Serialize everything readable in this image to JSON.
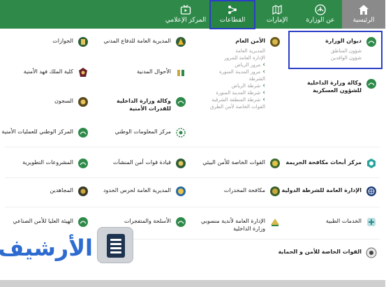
{
  "nav": {
    "home": "الرئيسية",
    "ministry": "عن الوزارة",
    "emirates": "الإمارات",
    "sectors": "القطاعات",
    "media": "المركز الإعلامي"
  },
  "col1": [
    {
      "title": "ديوان الوزارة",
      "subs": [
        "شؤون المناطق",
        "شؤون الوافدين"
      ]
    },
    {
      "title": "وكالة وزارة الداخلية للشؤون العسكرية"
    },
    {
      "title": "مركز أبحاث مكافحة الجريمة"
    },
    {
      "title": "الإدارة العامة للشرطة الدولية"
    },
    {
      "title": "الخدمات الطبية"
    },
    {
      "title": "القوات الخاصة للأمن و الحماية"
    }
  ],
  "col2": [
    {
      "title": "الأمن العام",
      "subs": [
        "المديرية العامة",
        "الإدارة العامة للمرور",
        "مرور الرياض",
        "مرور المدينة المنورة",
        "الشرطة",
        "شرطة الرياض",
        "شرطة المدينة المنورة",
        "شرطة المنطقة الشرقية",
        "القوات الخاصة لأمن الطرق"
      ]
    },
    {
      "title": "القوات الخاصة للأمن البيئي"
    },
    {
      "title": "مكافحة المخدرات"
    },
    {
      "title": "الإدارة العامة لأندية منسوبي وزارة الداخلية"
    }
  ],
  "col3": [
    {
      "title": "المديرية العامة للدفاع المدني"
    },
    {
      "title": "الأحوال المدنية"
    },
    {
      "title": "وكالة وزارة الداخلية للقدرات الأمنية"
    },
    {
      "title": "مركز المعلومات الوطني"
    },
    {
      "title": "قيادة قوات أمن المنشآت"
    },
    {
      "title": "المديرية العامة لحرس الحدود"
    },
    {
      "title": "الأسلحة والمتفجرات"
    }
  ],
  "col4": [
    {
      "title": "الجوازات"
    },
    {
      "title": "كلية الملك فهد الأمنية"
    },
    {
      "title": "السجون"
    },
    {
      "title": "المركز الوطني للعمليات الأمنية"
    },
    {
      "title": "المشروعات التطويرية"
    },
    {
      "title": "المجاهدين"
    },
    {
      "title": "الهيئة العليا للأمن الصناعي"
    }
  ],
  "archive": {
    "label": "الأرشيف"
  },
  "colors": {
    "nav_green": "#2f8a4a",
    "highlight_blue": "#2b3ec7",
    "archive_blue": "#2d6bd0"
  }
}
